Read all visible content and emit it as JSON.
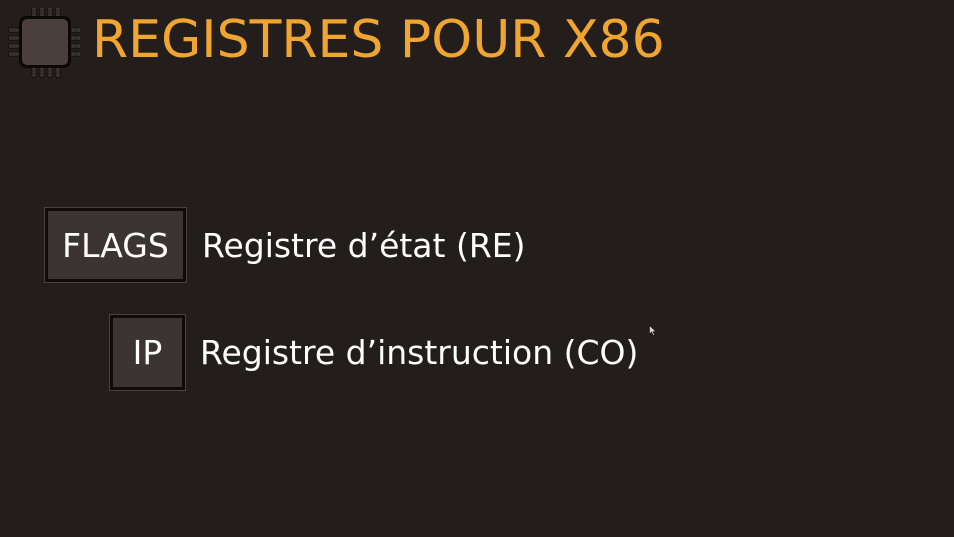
{
  "title": "REGISTRES POUR X86",
  "icons": {
    "logo": "cpu-chip-icon",
    "pointer": "mouse-cursor-icon"
  },
  "colors": {
    "background": "#231e1c",
    "title": "#f1a531",
    "register_box": "#3b3432",
    "text": "#ffffff"
  },
  "registers": [
    {
      "name": "FLAGS",
      "description": "Registre d’état (RE)"
    },
    {
      "name": "IP",
      "description": "Registre d’instruction (CO)"
    }
  ]
}
